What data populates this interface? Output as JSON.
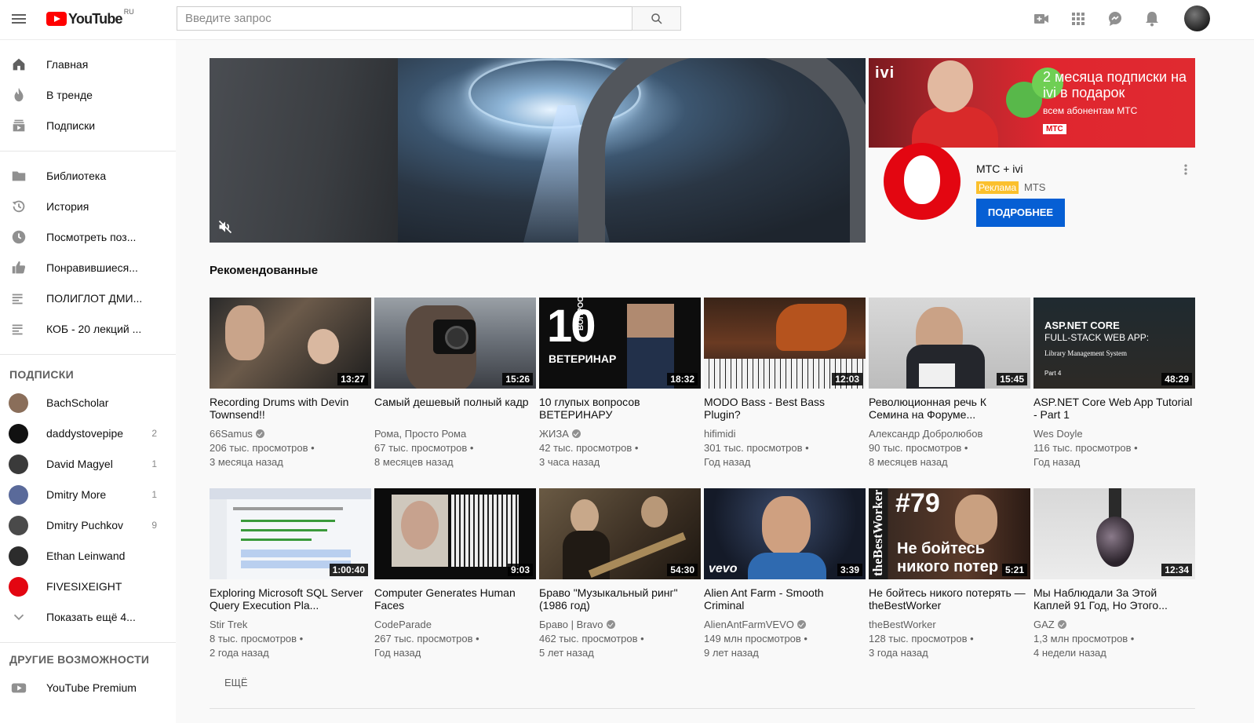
{
  "header": {
    "logo_text": "YouTube",
    "logo_region": "RU",
    "search_placeholder": "Введите запрос",
    "icons": [
      "menu-icon",
      "search-icon",
      "video-camera-icon",
      "apps-grid-icon",
      "messages-icon",
      "bell-icon"
    ]
  },
  "sidebar": {
    "main": [
      {
        "label": "Главная",
        "icon": "home-icon"
      },
      {
        "label": "В тренде",
        "icon": "flame-icon"
      },
      {
        "label": "Подписки",
        "icon": "subscriptions-icon"
      }
    ],
    "library": [
      {
        "label": "Библиотека",
        "icon": "folder-icon"
      },
      {
        "label": "История",
        "icon": "history-icon"
      },
      {
        "label": "Посмотреть поз...",
        "icon": "clock-icon"
      },
      {
        "label": "Понравившиеся...",
        "icon": "thumb-up-icon"
      },
      {
        "label": "ПОЛИГЛОТ ДМИ...",
        "icon": "playlist-icon"
      },
      {
        "label": "КОБ - 20 лекций ...",
        "icon": "playlist-icon"
      }
    ],
    "subs_heading": "ПОДПИСКИ",
    "subs": [
      {
        "label": "BachScholar",
        "count": "",
        "color": "#8a6e5a"
      },
      {
        "label": "daddystovepipe",
        "count": "2",
        "color": "#111111"
      },
      {
        "label": "David Magyel",
        "count": "1",
        "color": "#3a3a3a"
      },
      {
        "label": "Dmitry More",
        "count": "1",
        "color": "#5a6a9a"
      },
      {
        "label": "Dmitry Puchkov",
        "count": "9",
        "color": "#4a4a4a"
      },
      {
        "label": "Ethan Leinwand",
        "count": "",
        "color": "#2c2c2c"
      },
      {
        "label": "FIVESIXEIGHT",
        "count": "",
        "color": "#e30611"
      },
      {
        "label": "Показать ещё 4...",
        "count": "",
        "color": ""
      }
    ],
    "other_heading": "ДРУГИЕ ВОЗМОЖНОСТИ",
    "other": [
      {
        "label": "YouTube Premium",
        "icon": "youtube-icon"
      }
    ]
  },
  "ad": {
    "banner_logo": "ivi",
    "banner_headline": "2 месяца подписки на ivi в подарок",
    "banner_sub": "всем абонентам МТС",
    "banner_mts": "МТС",
    "title": "МТС + ivi",
    "badge": "Реклама",
    "brand": "MTS",
    "button": "ПОДРОБНЕЕ"
  },
  "section_title": "Рекомендованные",
  "videos": [
    {
      "title": "Recording Drums with Devin Townsend!!",
      "channel": "66Samus",
      "verified": true,
      "views": "206 тыс. просмотров •",
      "age": "3 месяца назад",
      "duration": "13:27"
    },
    {
      "title": "Самый дешевый полный кадр",
      "channel": "Рома, Просто Рома",
      "verified": false,
      "views": "67 тыс. просмотров •",
      "age": "8 месяцев назад",
      "duration": "15:26"
    },
    {
      "title": "10 глупых вопросов ВЕТЕРИНАРУ",
      "channel": "ЖИЗА",
      "verified": true,
      "views": "42 тыс. просмотров •",
      "age": "3 часа назад",
      "duration": "18:32",
      "thumb_big": "10",
      "thumb_side": "ВОПРОСОВ",
      "thumb_bottom": "ВЕТЕРИНАР"
    },
    {
      "title": "MODO Bass - Best Bass Plugin?",
      "channel": "hifimidi",
      "verified": false,
      "views": "301 тыс. просмотров •",
      "age": "Год назад",
      "duration": "12:03"
    },
    {
      "title": "Революционная речь К Семина на Форуме...",
      "channel": "Александр Добролюбов",
      "verified": false,
      "views": "90 тыс. просмотров •",
      "age": "8 месяцев назад",
      "duration": "15:45"
    },
    {
      "title": "ASP.NET Core Web App Tutorial - Part 1",
      "channel": "Wes Doyle",
      "verified": false,
      "views": "116 тыс. просмотров •",
      "age": "Год назад",
      "duration": "48:29",
      "thumb_l1": "ASP.NET CORE",
      "thumb_l2": "FULL-STACK WEB APP:",
      "thumb_l3": "Library Management System",
      "thumb_l4": "Part 4"
    },
    {
      "title": "Exploring Microsoft SQL Server Query Execution Pla...",
      "channel": "Stir Trek",
      "verified": false,
      "views": "8 тыс. просмотров •",
      "age": "2 года назад",
      "duration": "1:00:40"
    },
    {
      "title": "Computer Generates Human Faces",
      "channel": "CodeParade",
      "verified": false,
      "views": "267 тыс. просмотров •",
      "age": "Год назад",
      "duration": "9:03"
    },
    {
      "title": "Браво \"Музыкальный ринг\" (1986 год)",
      "channel": "Браво | Bravo",
      "verified": true,
      "views": "462 тыс. просмотров •",
      "age": "5 лет назад",
      "duration": "54:30"
    },
    {
      "title": "Alien Ant Farm - Smooth Criminal",
      "channel": "AlienAntFarmVEVO",
      "verified": true,
      "views": "149 млн просмотров •",
      "age": "9 лет назад",
      "duration": "3:39",
      "thumb_vevo": "vevo"
    },
    {
      "title": "Не бойтесь никого потерять — theBestWorker",
      "channel": "theBestWorker",
      "verified": false,
      "views": "128 тыс. просмотров •",
      "age": "3 года назад",
      "duration": "5:21",
      "thumb_num": "#79",
      "thumb_l1": "Не бойтесь",
      "thumb_l2": "никого потер",
      "thumb_side": "theBestWorker"
    },
    {
      "title": "Мы Наблюдали За Этой Каплей 91 Год, Но Этого...",
      "channel": "GAZ",
      "verified": true,
      "views": "1,3 млн просмотров •",
      "age": "4 недели назад",
      "duration": "12:34"
    }
  ],
  "more_label": "ЕЩЁ"
}
